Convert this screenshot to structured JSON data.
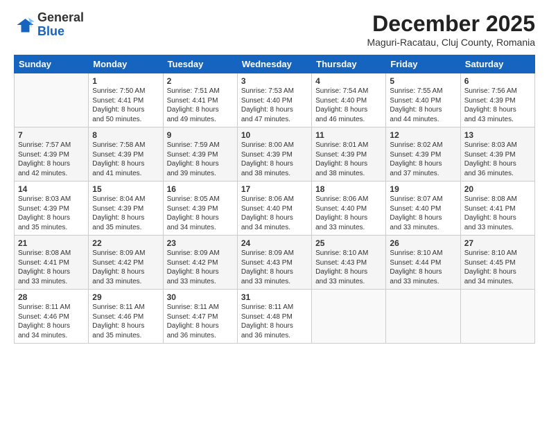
{
  "header": {
    "logo_line1": "General",
    "logo_line2": "Blue",
    "month": "December 2025",
    "location": "Maguri-Racatau, Cluj County, Romania"
  },
  "weekdays": [
    "Sunday",
    "Monday",
    "Tuesday",
    "Wednesday",
    "Thursday",
    "Friday",
    "Saturday"
  ],
  "weeks": [
    [
      {
        "day": "",
        "content": ""
      },
      {
        "day": "1",
        "content": "Sunrise: 7:50 AM\nSunset: 4:41 PM\nDaylight: 8 hours\nand 50 minutes."
      },
      {
        "day": "2",
        "content": "Sunrise: 7:51 AM\nSunset: 4:41 PM\nDaylight: 8 hours\nand 49 minutes."
      },
      {
        "day": "3",
        "content": "Sunrise: 7:53 AM\nSunset: 4:40 PM\nDaylight: 8 hours\nand 47 minutes."
      },
      {
        "day": "4",
        "content": "Sunrise: 7:54 AM\nSunset: 4:40 PM\nDaylight: 8 hours\nand 46 minutes."
      },
      {
        "day": "5",
        "content": "Sunrise: 7:55 AM\nSunset: 4:40 PM\nDaylight: 8 hours\nand 44 minutes."
      },
      {
        "day": "6",
        "content": "Sunrise: 7:56 AM\nSunset: 4:39 PM\nDaylight: 8 hours\nand 43 minutes."
      }
    ],
    [
      {
        "day": "7",
        "content": "Sunrise: 7:57 AM\nSunset: 4:39 PM\nDaylight: 8 hours\nand 42 minutes."
      },
      {
        "day": "8",
        "content": "Sunrise: 7:58 AM\nSunset: 4:39 PM\nDaylight: 8 hours\nand 41 minutes."
      },
      {
        "day": "9",
        "content": "Sunrise: 7:59 AM\nSunset: 4:39 PM\nDaylight: 8 hours\nand 39 minutes."
      },
      {
        "day": "10",
        "content": "Sunrise: 8:00 AM\nSunset: 4:39 PM\nDaylight: 8 hours\nand 38 minutes."
      },
      {
        "day": "11",
        "content": "Sunrise: 8:01 AM\nSunset: 4:39 PM\nDaylight: 8 hours\nand 38 minutes."
      },
      {
        "day": "12",
        "content": "Sunrise: 8:02 AM\nSunset: 4:39 PM\nDaylight: 8 hours\nand 37 minutes."
      },
      {
        "day": "13",
        "content": "Sunrise: 8:03 AM\nSunset: 4:39 PM\nDaylight: 8 hours\nand 36 minutes."
      }
    ],
    [
      {
        "day": "14",
        "content": "Sunrise: 8:03 AM\nSunset: 4:39 PM\nDaylight: 8 hours\nand 35 minutes."
      },
      {
        "day": "15",
        "content": "Sunrise: 8:04 AM\nSunset: 4:39 PM\nDaylight: 8 hours\nand 35 minutes."
      },
      {
        "day": "16",
        "content": "Sunrise: 8:05 AM\nSunset: 4:39 PM\nDaylight: 8 hours\nand 34 minutes."
      },
      {
        "day": "17",
        "content": "Sunrise: 8:06 AM\nSunset: 4:40 PM\nDaylight: 8 hours\nand 34 minutes."
      },
      {
        "day": "18",
        "content": "Sunrise: 8:06 AM\nSunset: 4:40 PM\nDaylight: 8 hours\nand 33 minutes."
      },
      {
        "day": "19",
        "content": "Sunrise: 8:07 AM\nSunset: 4:40 PM\nDaylight: 8 hours\nand 33 minutes."
      },
      {
        "day": "20",
        "content": "Sunrise: 8:08 AM\nSunset: 4:41 PM\nDaylight: 8 hours\nand 33 minutes."
      }
    ],
    [
      {
        "day": "21",
        "content": "Sunrise: 8:08 AM\nSunset: 4:41 PM\nDaylight: 8 hours\nand 33 minutes."
      },
      {
        "day": "22",
        "content": "Sunrise: 8:09 AM\nSunset: 4:42 PM\nDaylight: 8 hours\nand 33 minutes."
      },
      {
        "day": "23",
        "content": "Sunrise: 8:09 AM\nSunset: 4:42 PM\nDaylight: 8 hours\nand 33 minutes."
      },
      {
        "day": "24",
        "content": "Sunrise: 8:09 AM\nSunset: 4:43 PM\nDaylight: 8 hours\nand 33 minutes."
      },
      {
        "day": "25",
        "content": "Sunrise: 8:10 AM\nSunset: 4:43 PM\nDaylight: 8 hours\nand 33 minutes."
      },
      {
        "day": "26",
        "content": "Sunrise: 8:10 AM\nSunset: 4:44 PM\nDaylight: 8 hours\nand 33 minutes."
      },
      {
        "day": "27",
        "content": "Sunrise: 8:10 AM\nSunset: 4:45 PM\nDaylight: 8 hours\nand 34 minutes."
      }
    ],
    [
      {
        "day": "28",
        "content": "Sunrise: 8:11 AM\nSunset: 4:46 PM\nDaylight: 8 hours\nand 34 minutes."
      },
      {
        "day": "29",
        "content": "Sunrise: 8:11 AM\nSunset: 4:46 PM\nDaylight: 8 hours\nand 35 minutes."
      },
      {
        "day": "30",
        "content": "Sunrise: 8:11 AM\nSunset: 4:47 PM\nDaylight: 8 hours\nand 36 minutes."
      },
      {
        "day": "31",
        "content": "Sunrise: 8:11 AM\nSunset: 4:48 PM\nDaylight: 8 hours\nand 36 minutes."
      },
      {
        "day": "",
        "content": ""
      },
      {
        "day": "",
        "content": ""
      },
      {
        "day": "",
        "content": ""
      }
    ]
  ]
}
